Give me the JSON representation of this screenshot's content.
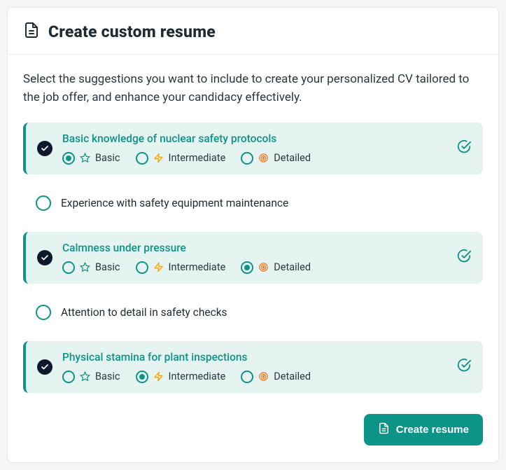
{
  "header": {
    "title": "Create custom resume"
  },
  "intro": "Select the suggestions you want to include to create your personalized CV tailored to the job offer, and enhance your candidacy effectively.",
  "levels": {
    "basic": "Basic",
    "intermediate": "Intermediate",
    "detailed": "Detailed"
  },
  "items": [
    {
      "title": "Basic knowledge of nuclear safety protocols",
      "selected": true,
      "level": "basic"
    },
    {
      "title": "Experience with safety equipment maintenance",
      "selected": false
    },
    {
      "title": "Calmness under pressure",
      "selected": true,
      "level": "detailed"
    },
    {
      "title": "Attention to detail in safety checks",
      "selected": false
    },
    {
      "title": "Physical stamina for plant inspections",
      "selected": true,
      "level": "intermediate"
    }
  ],
  "button": {
    "label": "Create resume"
  },
  "colors": {
    "teal": "#0d9488",
    "tealLight": "#e6f4f1",
    "dark": "#0f172a",
    "orange": "#f59e0b"
  }
}
